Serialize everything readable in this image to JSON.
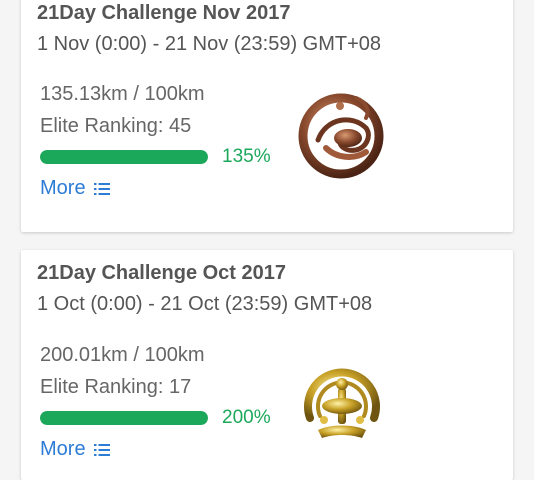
{
  "challenges": [
    {
      "title": "21Day Challenge Nov 2017",
      "dates": "1 Nov (0:00) - 21 Nov (23:59) GMT+08",
      "distance": "135.13km / 100km",
      "ranking": "Elite Ranking: 45",
      "percent_label": "135%",
      "progress_fraction": 1.0,
      "more_label": "More",
      "more_icon": "list-icon",
      "medal_icon": "scorpion-medal-icon",
      "medal_color": "#8a4a2e"
    },
    {
      "title": "21Day Challenge Oct 2017",
      "dates": "1 Oct (0:00) - 21 Oct (23:59) GMT+08",
      "distance": "200.01km / 100km",
      "ranking": "Elite Ranking: 17",
      "percent_label": "200%",
      "progress_fraction": 1.0,
      "more_label": "More",
      "more_icon": "list-icon",
      "medal_icon": "golden-medal-icon",
      "medal_color": "#c9a227"
    }
  ],
  "colors": {
    "progress": "#1ca85a",
    "link": "#2d7cd6",
    "text": "#555555"
  }
}
